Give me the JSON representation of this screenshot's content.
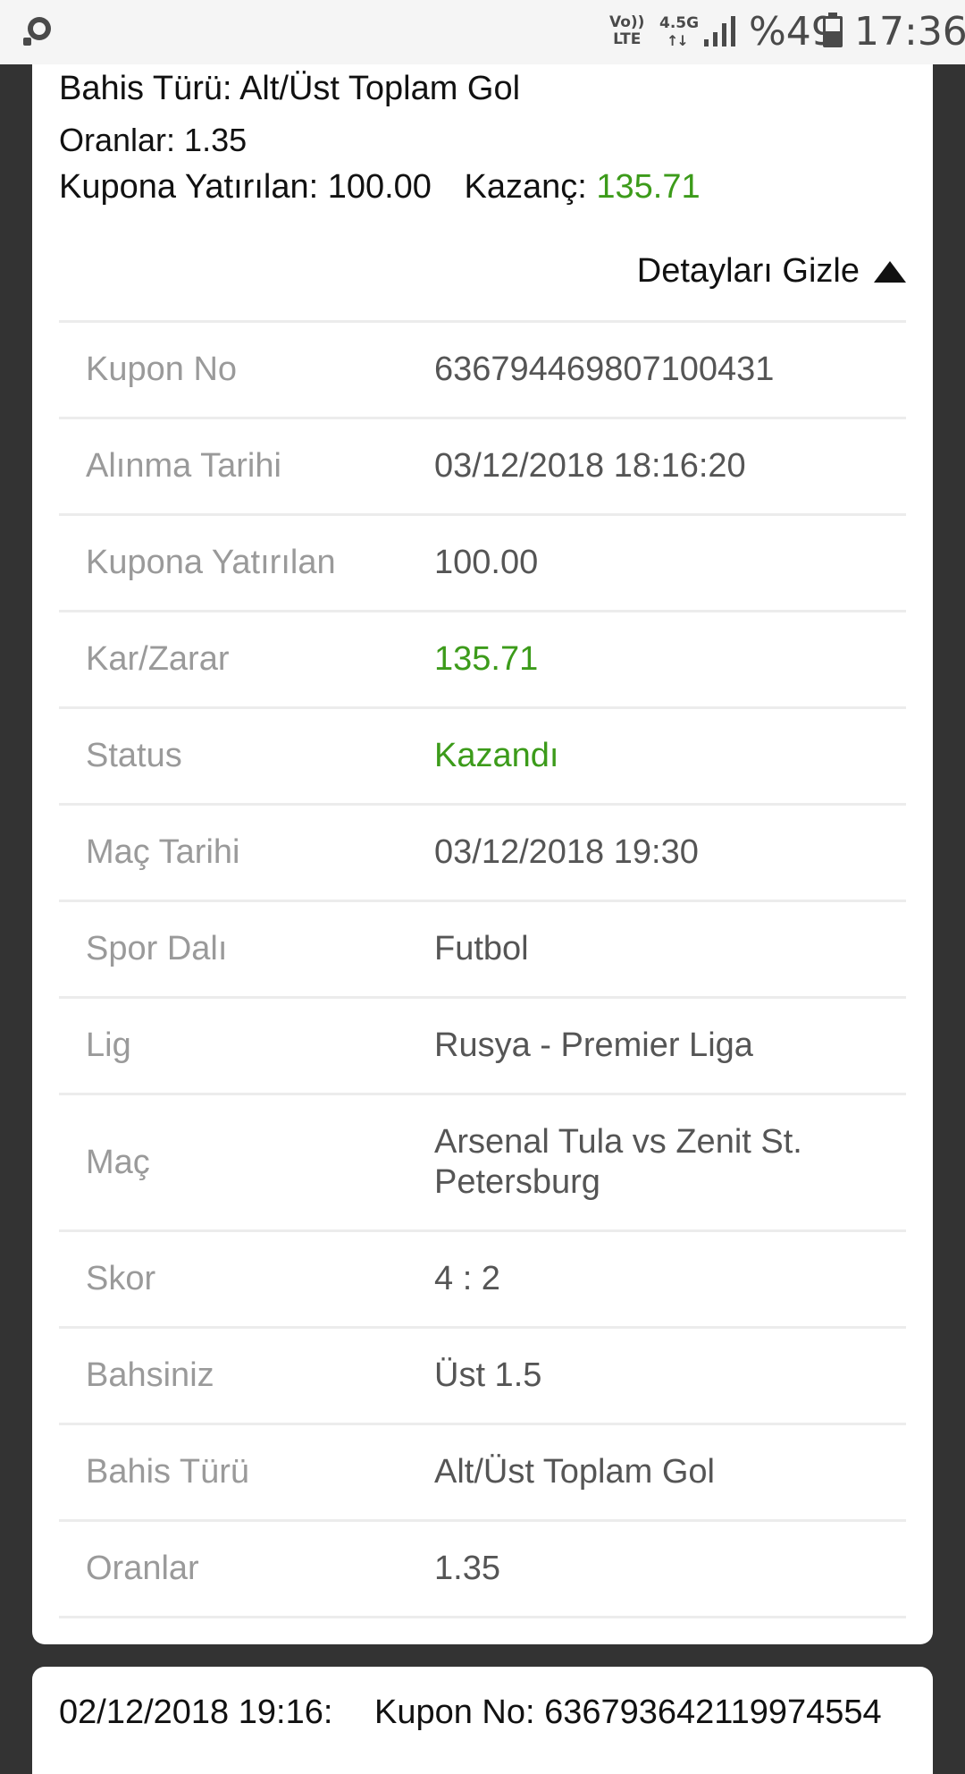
{
  "status_bar": {
    "volte_top": "Vo))",
    "volte_bottom": "LTE",
    "network": "4.5G",
    "network_arrows": "↑↓",
    "battery": "%49",
    "time": "17:36",
    "app_icon": "search-bubble-icon",
    "signal_icon": "signal-icon",
    "battery_icon": "battery-icon"
  },
  "summary": {
    "bet_type": "Bahis Türü: Alt/Üst Toplam Gol",
    "odds": "Oranlar: 1.35",
    "stake": "Kupona Yatırılan: 100.00",
    "gain_label": "Kazanç:",
    "gain_value": "135.71",
    "toggle_label": "Detayları Gizle",
    "accent_green": "#3c9b1a"
  },
  "details": [
    {
      "label": "Kupon No",
      "value": "636794469807100431"
    },
    {
      "label": "Alınma Tarihi",
      "value": "03/12/2018 18:16:20"
    },
    {
      "label": "Kupona Yatırılan",
      "value": "100.00"
    },
    {
      "label": "Kar/Zarar",
      "value": "135.71"
    },
    {
      "label": "Status",
      "value": "Kazandı"
    },
    {
      "label": "Maç Tarihi",
      "value": "03/12/2018 19:30"
    },
    {
      "label": "Spor Dalı",
      "value": "Futbol"
    },
    {
      "label": "Lig",
      "value": "Rusya - Premier Liga"
    },
    {
      "label": "Maç",
      "value": "Arsenal Tula vs Zenit St. Petersburg"
    },
    {
      "label": "Skor",
      "value": "4 : 2"
    },
    {
      "label": "Bahsiniz",
      "value": "Üst 1.5"
    },
    {
      "label": "Bahis Türü",
      "value": "Alt/Üst Toplam Gol"
    },
    {
      "label": "Oranlar",
      "value": "1.35"
    }
  ],
  "next_card": {
    "date": "02/12/2018 19:16:",
    "coupon": "Kupon No: 636793642119974554"
  }
}
